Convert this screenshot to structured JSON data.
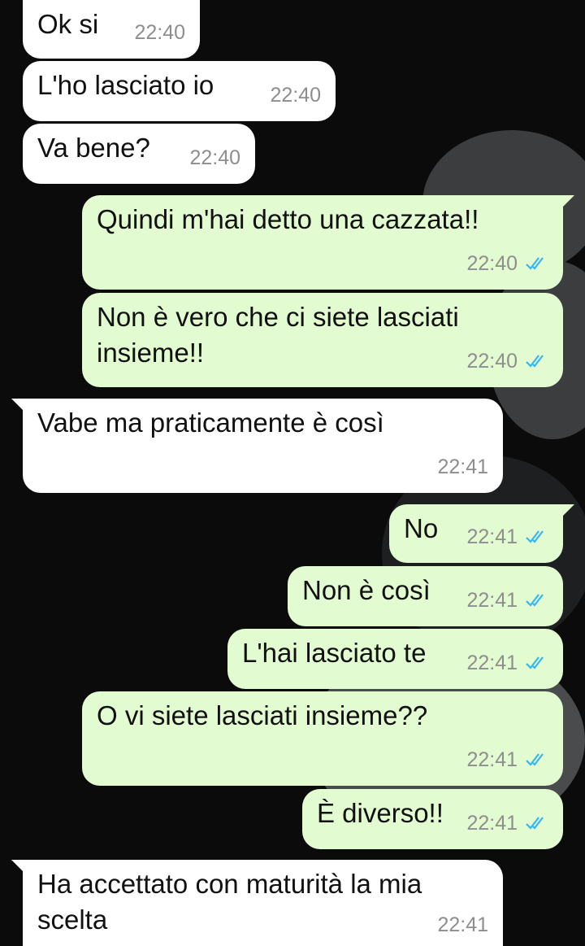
{
  "chat": {
    "messages": [
      {
        "text": "Ok si",
        "time": "22:40",
        "direction": "incoming"
      },
      {
        "text": "L'ho lasciato io",
        "time": "22:40",
        "direction": "incoming"
      },
      {
        "text": "Va bene?",
        "time": "22:40",
        "direction": "incoming"
      },
      {
        "text": "Quindi m'hai detto una cazzata!!",
        "time": "22:40",
        "direction": "outgoing",
        "status": "read"
      },
      {
        "text": "Non è vero che ci siete lasciati insieme!!",
        "time": "22:40",
        "direction": "outgoing",
        "status": "read"
      },
      {
        "text": "Vabe ma praticamente è così",
        "time": "22:41",
        "direction": "incoming"
      },
      {
        "text": "No",
        "time": "22:41",
        "direction": "outgoing",
        "status": "read"
      },
      {
        "text": "Non è così",
        "time": "22:41",
        "direction": "outgoing",
        "status": "read"
      },
      {
        "text": "L'hai lasciato te",
        "time": "22:41",
        "direction": "outgoing",
        "status": "read"
      },
      {
        "text": "O vi siete lasciati insieme??",
        "time": "22:41",
        "direction": "outgoing",
        "status": "read"
      },
      {
        "text": "È diverso!!",
        "time": "22:41",
        "direction": "outgoing",
        "status": "read"
      },
      {
        "text": "Ha accettato con maturità la mia scelta",
        "time": "22:41",
        "direction": "incoming"
      }
    ]
  },
  "colors": {
    "background": "#0b0b0b",
    "incoming_bubble": "#ffffff",
    "outgoing_bubble": "#e3fbd1",
    "read_ticks": "#34b7f1",
    "timestamp": "#8e8e8e"
  },
  "icons": {
    "read_status": "double-check-icon"
  }
}
